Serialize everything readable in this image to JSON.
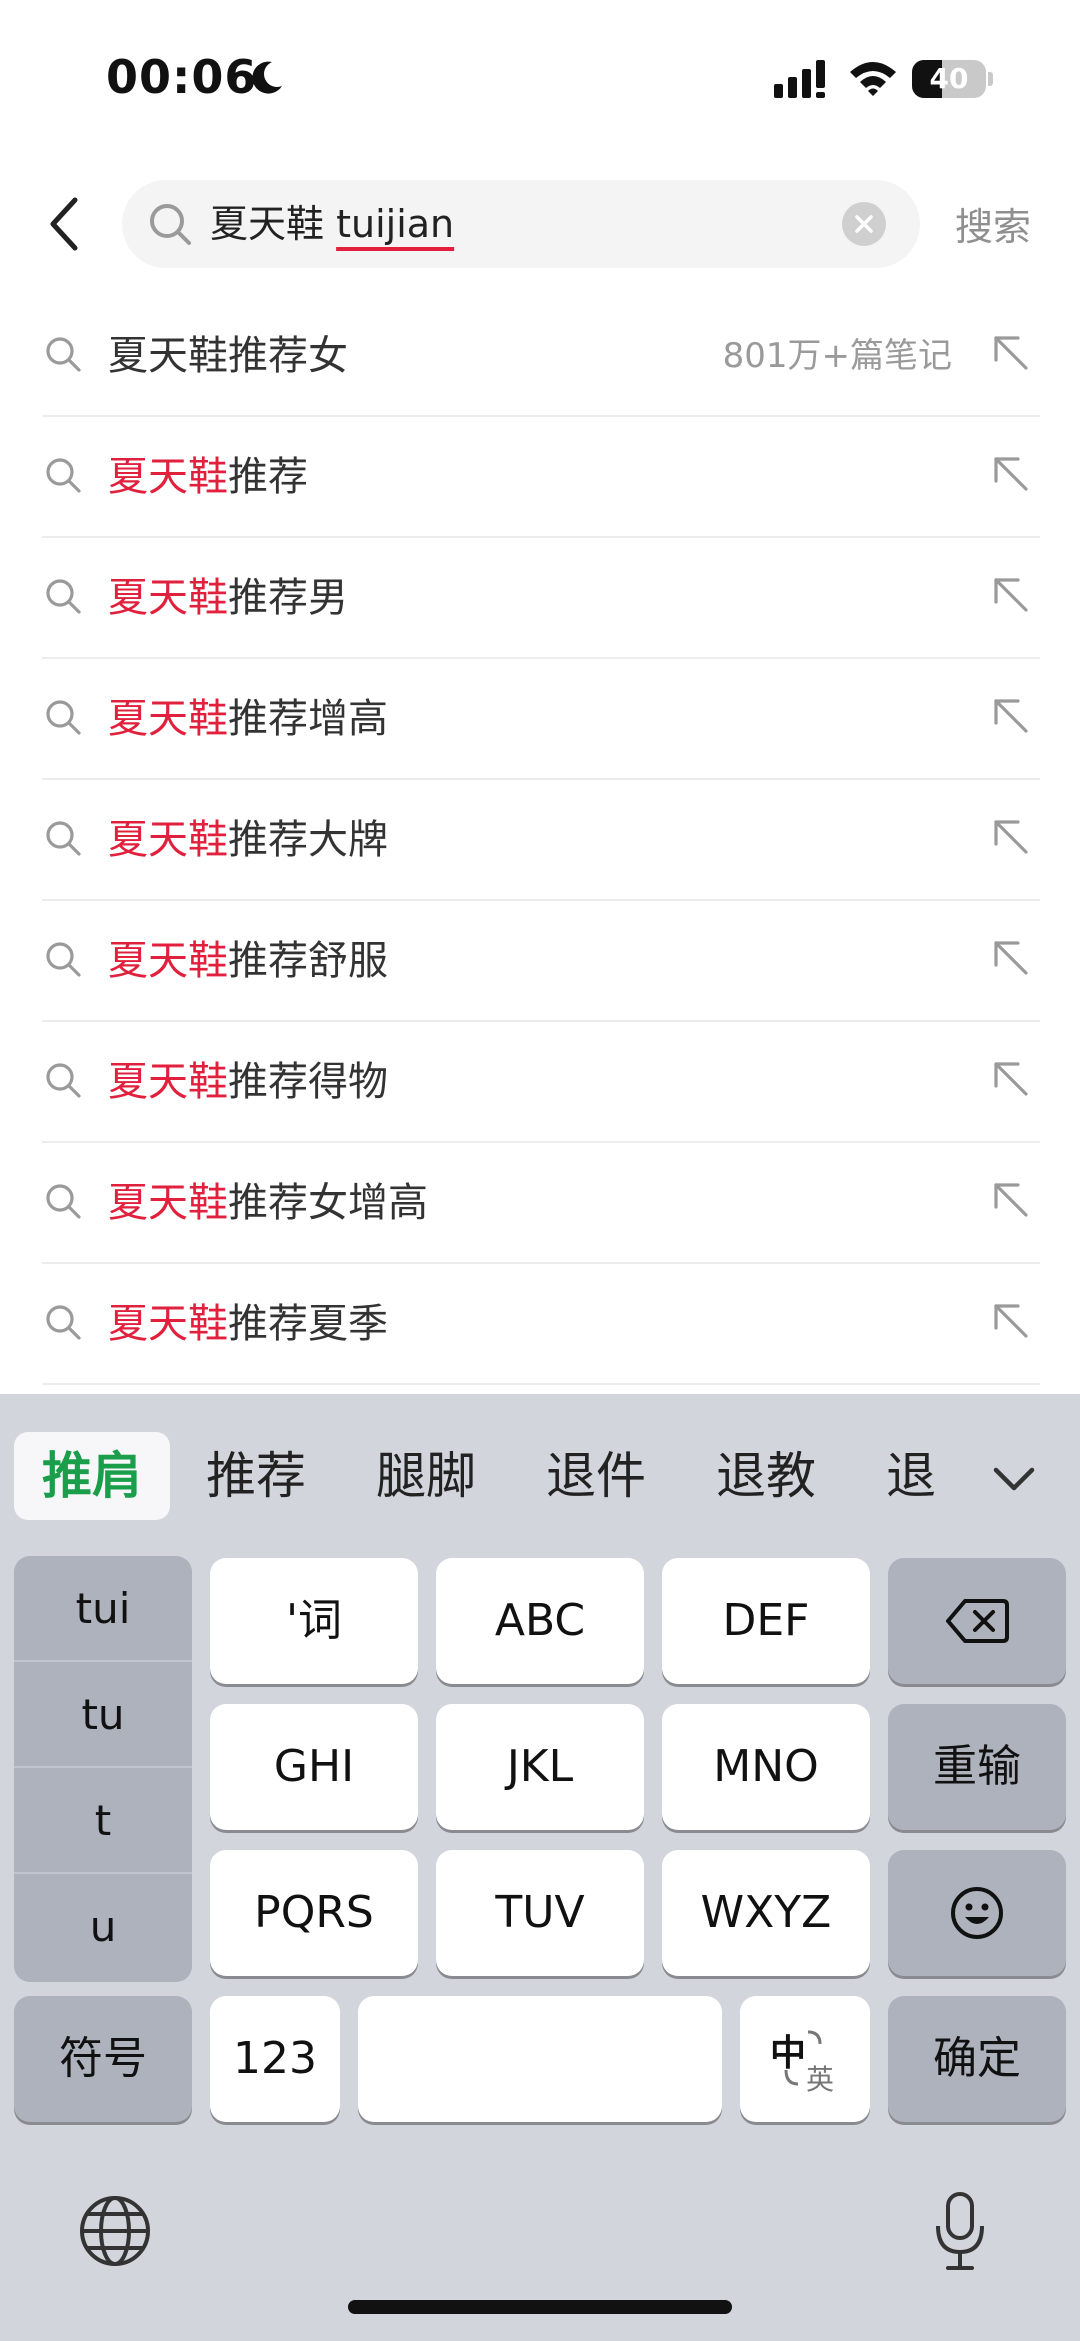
{
  "status_bar": {
    "time": "00:06",
    "battery": "40",
    "battery_level": 0.4
  },
  "search": {
    "query_prefix": "夏天鞋",
    "query_composing": "tuijian",
    "search_button": "搜索"
  },
  "suggestions": [
    {
      "highlight": "",
      "rest": "夏天鞋推荐女",
      "count": "801万+篇笔记"
    },
    {
      "highlight": "夏天鞋",
      "rest": "推荐",
      "count": ""
    },
    {
      "highlight": "夏天鞋",
      "rest": "推荐男",
      "count": ""
    },
    {
      "highlight": "夏天鞋",
      "rest": "推荐增高",
      "count": ""
    },
    {
      "highlight": "夏天鞋",
      "rest": "推荐大牌",
      "count": ""
    },
    {
      "highlight": "夏天鞋",
      "rest": "推荐舒服",
      "count": ""
    },
    {
      "highlight": "夏天鞋",
      "rest": "推荐得物",
      "count": ""
    },
    {
      "highlight": "夏天鞋",
      "rest": "推荐女增高",
      "count": ""
    },
    {
      "highlight": "夏天鞋",
      "rest": "推荐夏季",
      "count": ""
    }
  ],
  "keyboard": {
    "candidates": [
      "推肩",
      "推荐",
      "腿脚",
      "退件",
      "退教",
      "退"
    ],
    "pinyin": [
      "tui",
      "tu",
      "t",
      "u"
    ],
    "keys": {
      "apostrophe": "'词",
      "abc": "ABC",
      "def": "DEF",
      "ghi": "GHI",
      "jkl": "JKL",
      "mno": "MNO",
      "reenter": "重输",
      "pqrs": "PQRS",
      "tuv": "TUV",
      "wxyz": "WXYZ",
      "symbols": "符号",
      "numbers": "123",
      "lang_zh": "中",
      "lang_en": "英",
      "confirm": "确定"
    }
  }
}
